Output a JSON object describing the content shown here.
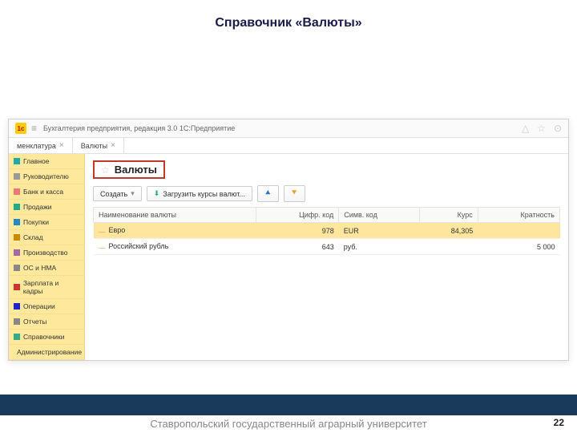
{
  "slide": {
    "title": "Справочник «Валюты»",
    "page_number": "22"
  },
  "app": {
    "title": "Бухгалтерия предприятия, редакция 3.0 1С:Предприятие"
  },
  "tabs": [
    {
      "label": "менклатура"
    },
    {
      "label": "Валюты"
    }
  ],
  "sidebar": {
    "items": [
      {
        "label": "Главное",
        "icon_color": "#2aa"
      },
      {
        "label": "Руководителю",
        "icon_color": "#999"
      },
      {
        "label": "Банк и касса",
        "icon_color": "#e77"
      },
      {
        "label": "Продажи",
        "icon_color": "#2a8"
      },
      {
        "label": "Покупки",
        "icon_color": "#28c"
      },
      {
        "label": "Склад",
        "icon_color": "#c80"
      },
      {
        "label": "Производство",
        "icon_color": "#a6a"
      },
      {
        "label": "ОС и НМА",
        "icon_color": "#888"
      },
      {
        "label": "Зарплата и кадры",
        "icon_color": "#c33"
      },
      {
        "label": "Операции",
        "icon_color": "#22c"
      },
      {
        "label": "Отчеты",
        "icon_color": "#888"
      },
      {
        "label": "Справочники",
        "icon_color": "#3a8"
      },
      {
        "label": "Администрирование",
        "icon_color": "#a33"
      }
    ]
  },
  "page": {
    "title": "Валюты"
  },
  "toolbar": {
    "create_label": "Создать",
    "load_rates_label": "Загрузить курсы валют..."
  },
  "table": {
    "headers": {
      "name": "Наименование валюты",
      "num_code": "Цифр. код",
      "sym_code": "Симв. код",
      "rate": "Курс",
      "multiplicity": "Кратность"
    },
    "rows": [
      {
        "name": "Евро",
        "num_code": "978",
        "sym_code": "EUR",
        "rate": "84,305",
        "multiplicity": "",
        "highlighted": true
      },
      {
        "name": "Российский рубль",
        "num_code": "643",
        "sym_code": "руб.",
        "rate": "",
        "multiplicity": "5 000",
        "highlighted": false
      }
    ]
  },
  "footer": {
    "text": "Ставропольский государственный аграрный университет"
  }
}
